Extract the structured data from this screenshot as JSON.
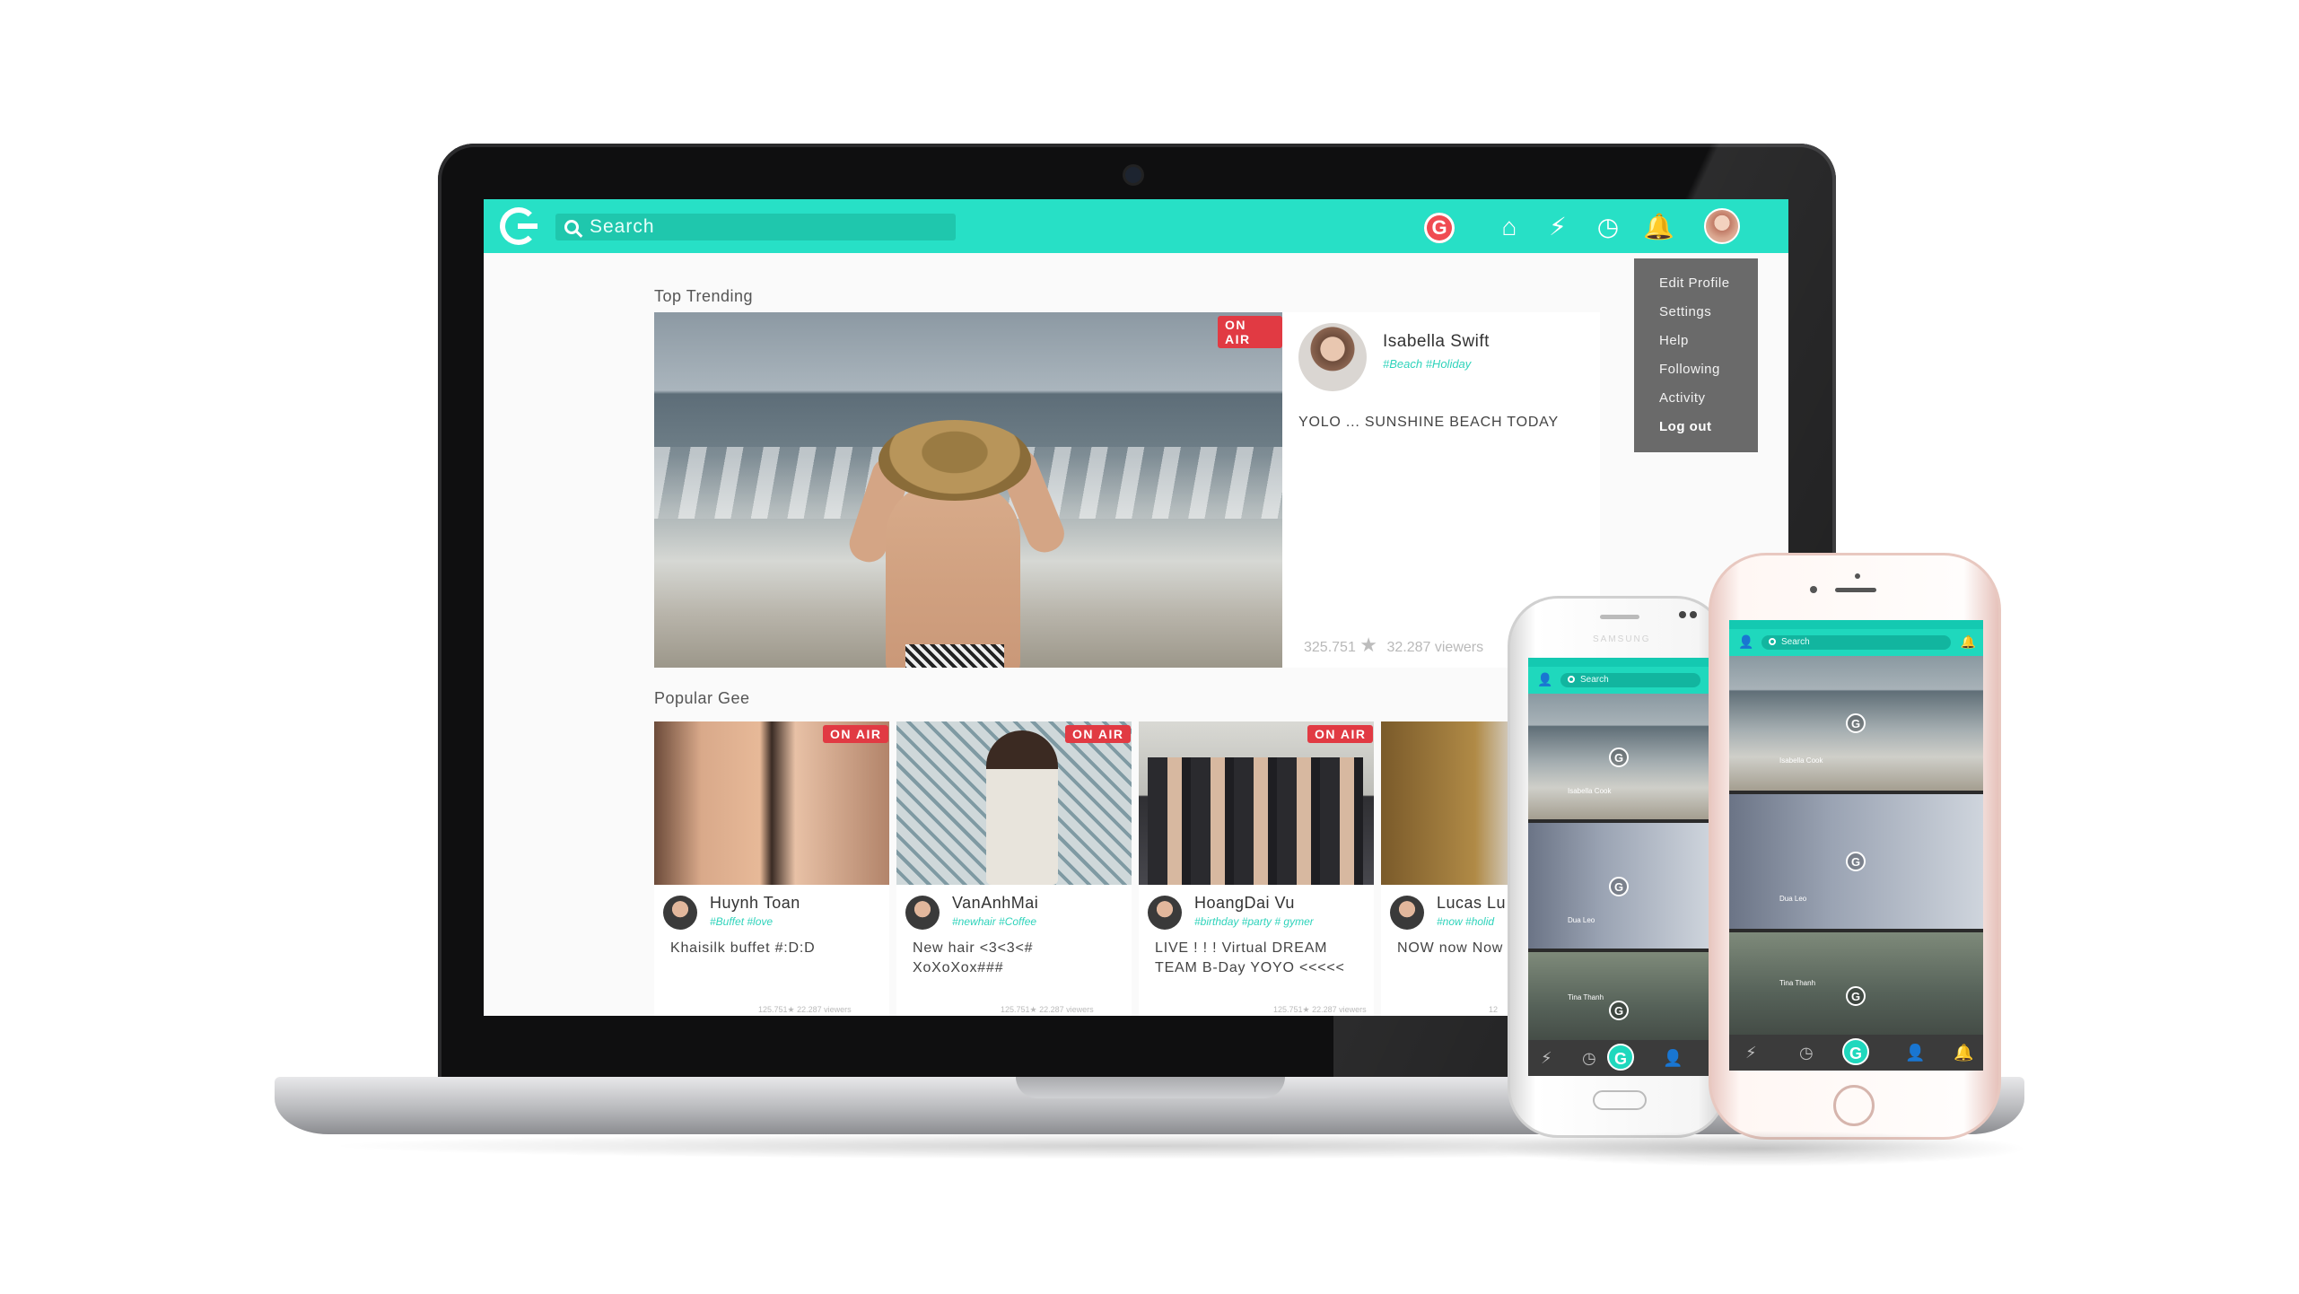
{
  "topbar": {
    "search_placeholder": "Search",
    "accent_color": "#27e0c6",
    "icons": [
      "g-logo-icon",
      "home-icon",
      "lightning-icon",
      "clock-icon",
      "bell-icon",
      "avatar"
    ]
  },
  "dropdown": {
    "items": [
      "Edit Profile",
      "Settings",
      "Help",
      "Following",
      "Activity",
      "Log out"
    ]
  },
  "sections": {
    "top_trending": "Top Trending",
    "popular_gee": "Popular Gee"
  },
  "badges": {
    "on_air": "ON AIR"
  },
  "featured": {
    "name": "Isabella Swift",
    "tags": "#Beach #Holiday",
    "caption": "YOLO ...  SUNSHINE BEACH TODAY",
    "likes": "325.751",
    "viewers": "32.287 viewers"
  },
  "cards": [
    {
      "name": "Huynh Toan",
      "tags": "#Buffet #love",
      "caption": "Khaisilk buffet #:D:D",
      "likes": "125.751",
      "viewers": "22.287 viewers"
    },
    {
      "name": "VanAnhMai",
      "tags": "#newhair #Coffee",
      "caption": "New hair <3<3<# XoXoXox###",
      "likes": "125.751",
      "viewers": "22.287 viewers"
    },
    {
      "name": "HoangDai Vu",
      "tags": "#birthday #party # gymer",
      "caption": "LIVE ! ! ! Virtual DREAM TEAM B-Day YOYO <<<<<",
      "likes": "125.751",
      "viewers": "22.287 viewers"
    },
    {
      "name": "Lucas Lu",
      "tags": "#now #holid",
      "caption": "NOW now Now Hi Malaysia !!!",
      "likes": "12",
      "viewers": ""
    }
  ],
  "phones": {
    "search_placeholder": "Search",
    "android_brand": "SAMSUNG",
    "tile_names": [
      "Isabella Cook",
      "Dua Leo",
      "Tina Thanh"
    ]
  }
}
